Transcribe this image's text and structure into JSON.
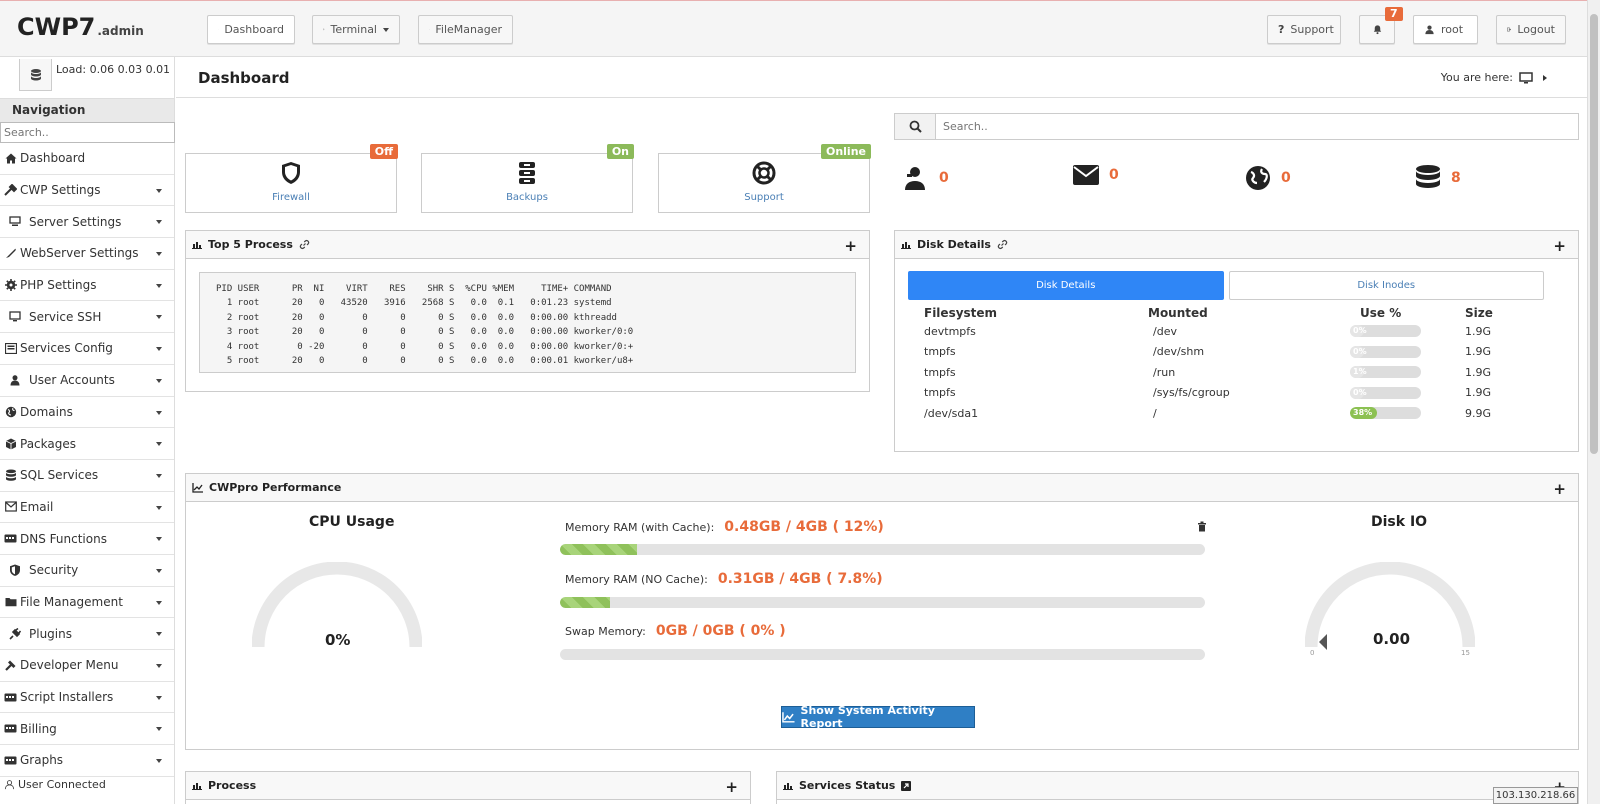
{
  "header": {
    "logo": "CWP7",
    "logo_suffix": ".admin",
    "buttons": {
      "dashboard": "Dashboard",
      "terminal": "Terminal",
      "filemanager": "FileManager",
      "support": "Support",
      "user": "root",
      "logout": "Logout"
    },
    "notification_count": "7"
  },
  "sidebar": {
    "load": "Load: 0.06  0.03  0.01",
    "nav_title": "Navigation",
    "search_placeholder": "Search..",
    "items": [
      {
        "label": "Dashboard",
        "icon": "home-icon"
      },
      {
        "label": "CWP Settings",
        "icon": "tools-icon"
      },
      {
        "label": "Server Settings",
        "icon": "server-icon"
      },
      {
        "label": "WebServer Settings",
        "icon": "feather-icon"
      },
      {
        "label": "PHP Settings",
        "icon": "gear-icon"
      },
      {
        "label": "Service SSH",
        "icon": "monitor-icon"
      },
      {
        "label": "Services Config",
        "icon": "services-icon"
      },
      {
        "label": "User Accounts",
        "icon": "user-icon"
      },
      {
        "label": "Domains",
        "icon": "globe-icon"
      },
      {
        "label": "Packages",
        "icon": "cubes-icon"
      },
      {
        "label": "SQL Services",
        "icon": "database-icon"
      },
      {
        "label": "Email",
        "icon": "email-icon"
      },
      {
        "label": "DNS Functions",
        "icon": "dns-icon"
      },
      {
        "label": "Security",
        "icon": "shield-icon"
      },
      {
        "label": "File Management",
        "icon": "folder-icon"
      },
      {
        "label": "Plugins",
        "icon": "plug-icon"
      },
      {
        "label": "Developer Menu",
        "icon": "hammer-icon"
      },
      {
        "label": "Script Installers",
        "icon": "script-icon"
      },
      {
        "label": "Billing",
        "icon": "billing-icon"
      },
      {
        "label": "Graphs",
        "icon": "graph-icon"
      }
    ],
    "user_connected": "User Connected"
  },
  "main": {
    "title": "Dashboard",
    "breadcrumb": "You are here:"
  },
  "status": {
    "firewall": {
      "label": "Firewall",
      "badge": "Off",
      "color": "#e86b3a"
    },
    "backups": {
      "label": "Backups",
      "badge": "On",
      "color": "#8cba5a"
    },
    "support": {
      "label": "Support",
      "badge": "Online",
      "color": "#8cba5a"
    }
  },
  "search": {
    "placeholder": "Search.."
  },
  "counters": {
    "users": "0",
    "emails": "0",
    "domains": "0",
    "databases": "8"
  },
  "top_process": {
    "title": "Top 5 Process",
    "header": "PID USER      PR  NI    VIRT    RES    SHR S  %CPU %MEM     TIME+ COMMAND",
    "rows": [
      "  1 root      20   0   43520   3916   2568 S   0.0  0.1   0:01.23 systemd",
      "  2 root      20   0       0      0      0 S   0.0  0.0   0:00.00 kthreadd",
      "  3 root      20   0       0      0      0 S   0.0  0.0   0:00.00 kworker/0:0",
      "  4 root       0 -20       0      0      0 S   0.0  0.0   0:00.00 kworker/0:+",
      "  5 root      20   0       0      0      0 S   0.0  0.0   0:00.01 kworker/u8+"
    ]
  },
  "disk": {
    "title": "Disk Details",
    "tabs": [
      "Disk Details",
      "Disk Inodes"
    ],
    "columns": [
      "Filesystem",
      "Mounted",
      "Use %",
      "Size"
    ],
    "rows": [
      {
        "fs": "devtmpfs",
        "mount": "/dev",
        "use": "0%",
        "use_frac": 0.2,
        "size": "1.9G"
      },
      {
        "fs": "tmpfs",
        "mount": "/dev/shm",
        "use": "0%",
        "use_frac": 0.2,
        "size": "1.9G"
      },
      {
        "fs": "tmpfs",
        "mount": "/run",
        "use": "1%",
        "use_frac": 0.2,
        "size": "1.9G"
      },
      {
        "fs": "tmpfs",
        "mount": "/sys/fs/cgroup",
        "use": "0%",
        "use_frac": 0.2,
        "size": "1.9G"
      },
      {
        "fs": "/dev/sda1",
        "mount": "/",
        "use": "38%",
        "use_frac": 0.38,
        "size": "9.9G"
      }
    ]
  },
  "performance": {
    "title": "CWPpro Performance",
    "cpu_title": "CPU Usage",
    "cpu_value": "0%",
    "diskio_title": "Disk IO",
    "diskio_value": "0.00",
    "diskio_min": "0",
    "diskio_max": "15",
    "mem_cache_label": "Memory RAM (with Cache):",
    "mem_cache_value": "0.48GB / 4GB ( 12%)",
    "mem_cache_frac": 0.12,
    "mem_nocache_label": "Memory RAM (NO Cache):",
    "mem_nocache_value": "0.31GB / 4GB ( 7.8%)",
    "mem_nocache_frac": 0.078,
    "swap_label": "Swap Memory:",
    "swap_value": "0GB / 0GB ( 0% )",
    "swap_frac": 0,
    "report_button": "Show System Activity Report"
  },
  "bottom_panels": {
    "process": "Process",
    "services": "Services Status"
  },
  "ip_address": "103.130.218.66"
}
